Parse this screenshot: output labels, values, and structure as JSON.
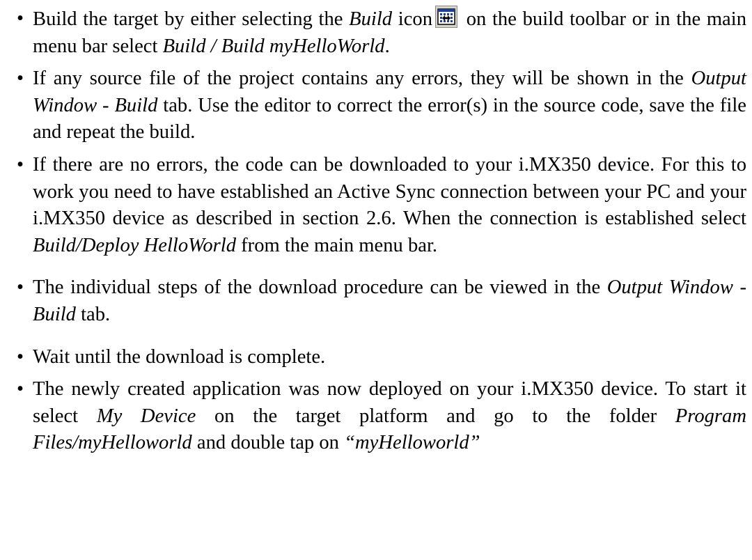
{
  "bullet_glyph": "•",
  "items": [
    {
      "t1": "Build the target by either selecting the ",
      "i1": "Build",
      "t2": " icon",
      "icon": "build-icon",
      "t3": " on the build toolbar or in the main menu bar select ",
      "i2": "Build / Build myHelloWorld",
      "t4": "."
    },
    {
      "t1": "If any source file of the project contains any errors, they will be shown in the ",
      "i1": "Output Window - Build",
      "t2": " tab. Use the editor to correct the error(s) in the source code, save the file and repeat the build."
    },
    {
      "t1": "If there are no errors, the code can be downloaded to your i.MX350 device. For this to work you need to have established an Active Sync connection between your PC and your i.MX350 device as described in section 2.6. When the connection is established select ",
      "i1": "Build/Deploy HelloWorld",
      "t2": " from the main menu bar."
    },
    {
      "t1": "The individual steps of the download procedure can be viewed in the ",
      "i1": "Output Window - Build",
      "t2": " tab."
    },
    {
      "t1": "Wait until the download is complete."
    },
    {
      "t1": "The newly created application was now deployed on your i.MX350 device. To start it select ",
      "i1": "My Device",
      "t2": " on the target platform and go to the folder ",
      "i2": "Program Files/myHelloworld",
      "t3": " and double tap on ",
      "i3": "“myHelloworld”"
    }
  ]
}
